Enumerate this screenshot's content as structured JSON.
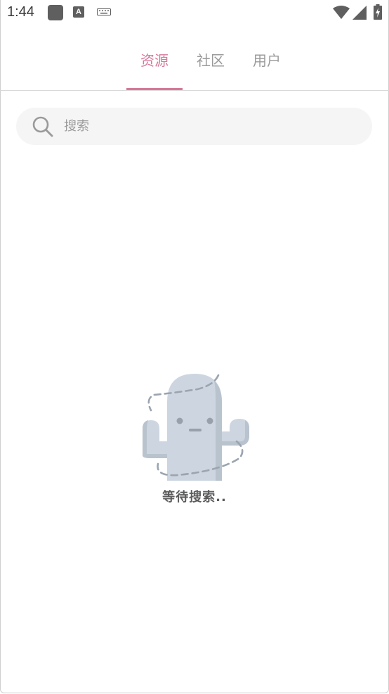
{
  "status_bar": {
    "time": "1:44",
    "keyboard_badge": "A"
  },
  "tabs": [
    {
      "label": "资源",
      "active": true
    },
    {
      "label": "社区",
      "active": false
    },
    {
      "label": "用户",
      "active": false
    }
  ],
  "search": {
    "placeholder": "搜索",
    "value": ""
  },
  "empty_state": {
    "message": "等待搜索..",
    "illustration": "cactus-icon"
  },
  "colors": {
    "accent": "#d6789a",
    "tab_inactive": "#9a9a9a",
    "search_bg": "#f5f5f5",
    "cactus": "#cdd6e0"
  }
}
